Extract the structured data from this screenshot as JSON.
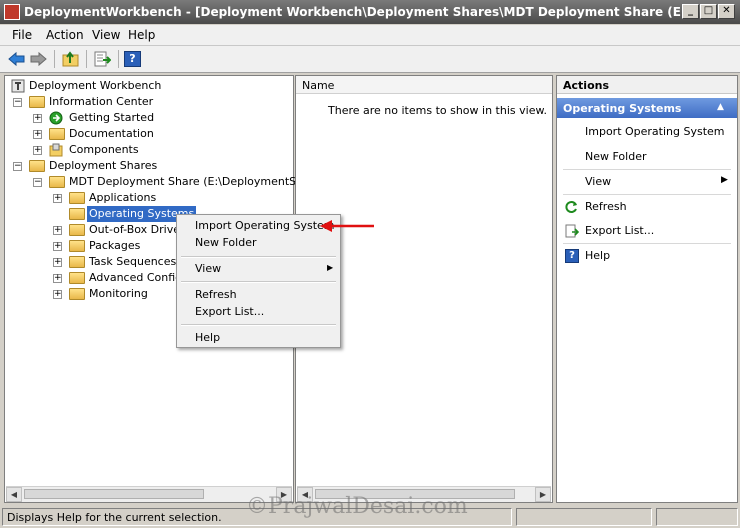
{
  "window": {
    "title": "DeploymentWorkbench - [Deployment Workbench\\Deployment Shares\\MDT Deployment Share (E:\\DeploymentSh...",
    "minimize": "_",
    "restore": "□",
    "close": "✕"
  },
  "menu": [
    "File",
    "Action",
    "View",
    "Help"
  ],
  "toolbar": {
    "icons": [
      "back-arrow-icon",
      "forward-arrow-icon",
      "up-folder-icon",
      "export-list-icon",
      "help-icon"
    ],
    "help_glyph": "?"
  },
  "tree": {
    "expand_glyph": "+",
    "collapse_glyph": "−",
    "items": [
      {
        "label": "Deployment Workbench"
      },
      {
        "label": "Information Center"
      },
      {
        "label": "Getting Started"
      },
      {
        "label": "Documentation"
      },
      {
        "label": "Components"
      },
      {
        "label": "Deployment Shares"
      },
      {
        "label": "MDT Deployment Share (E:\\DeploymentShare)"
      },
      {
        "label": "Applications"
      },
      {
        "label": "Operating Systems"
      },
      {
        "label": "Out-of-Box Drivers"
      },
      {
        "label": "Packages"
      },
      {
        "label": "Task Sequences"
      },
      {
        "label": "Advanced Configu"
      },
      {
        "label": "Monitoring"
      }
    ]
  },
  "context_menu": {
    "items": [
      "Import Operating System",
      "New Folder",
      "View",
      "Refresh",
      "Export List...",
      "Help"
    ],
    "submenu_arrow": "▶"
  },
  "list": {
    "column": "Name",
    "empty_message": "There are no items to show in this view."
  },
  "actions": {
    "header": "Actions",
    "section": "Operating Systems",
    "section_arrow": "▲",
    "items": [
      "Import Operating System",
      "New Folder",
      "View",
      "Refresh",
      "Export List...",
      "Help"
    ],
    "submenu_arrow": "▶"
  },
  "scroll": {
    "left": "◀",
    "right": "▶"
  },
  "status": {
    "text": "Displays Help for the current selection.",
    "watermark": "©PrajwalDesai.com"
  }
}
